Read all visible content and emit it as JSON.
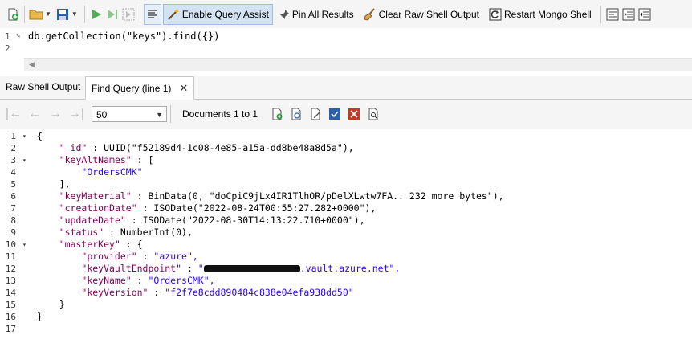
{
  "toolbar": {
    "new_icon": "new-document-icon",
    "open_icon": "folder-open-icon",
    "save_icon": "save-icon",
    "run_icon": "play-icon",
    "run_line_icon": "play-line-icon",
    "run_selected_icon": "play-selection-icon",
    "enable_query_assist": "Enable Query Assist",
    "pin_all_results": "Pin All Results",
    "clear_raw_shell_output": "Clear Raw Shell Output",
    "restart_mongo_shell": "Restart Mongo Shell"
  },
  "editor": {
    "lines": [
      {
        "number": "1",
        "text": "db.getCollection(\"keys\").find({})"
      },
      {
        "number": "2",
        "text": ""
      }
    ]
  },
  "tabs": [
    {
      "label": "Raw Shell Output",
      "active": false
    },
    {
      "label": "Find Query (line 1)",
      "active": true,
      "close": "✕"
    }
  ],
  "results": {
    "page_size": "50",
    "documents_label": "Documents 1 to 1"
  },
  "code": {
    "line_numbers": [
      "1",
      "2",
      "3",
      "4",
      "5",
      "6",
      "7",
      "8",
      "9",
      "10",
      "11",
      "12",
      "13",
      "14",
      "15",
      "16",
      "17"
    ],
    "l1": "{",
    "id_key": "\"_id\"",
    "id_val": "UUID(\"f52189d4-1c08-4e85-a15a-dd8be48a8d5a\"),",
    "keyAltNames_key": "\"keyAltNames\"",
    "keyAltNames_open": "[",
    "alt_name": "\"OrdersCMK\"",
    "keyAltNames_close": "],",
    "keyMaterial_key": "\"keyMaterial\"",
    "keyMaterial_val": "BinData(0, \"doCpiC9jLx4IR1TlhOR/pDelXLwtw7FA.. 232 more bytes\"),",
    "creationDate_key": "\"creationDate\"",
    "creationDate_val": "ISODate(\"2022-08-24T00:55:27.282+0000\"),",
    "updateDate_key": "\"updateDate\"",
    "updateDate_val": "ISODate(\"2022-08-30T14:13:22.710+0000\"),",
    "status_key": "\"status\"",
    "status_val": "NumberInt(0),",
    "masterKey_key": "\"masterKey\"",
    "masterKey_open": "{",
    "provider_key": "\"provider\"",
    "provider_val": "\"azure\",",
    "keyVaultEndpoint_key": "\"keyVaultEndpoint\"",
    "keyVaultEndpoint_prefix": "\"",
    "keyVaultEndpoint_suffix": ".vault.azure.net\",",
    "keyName_key": "\"keyName\"",
    "keyName_val": "\"OrdersCMK\",",
    "keyVersion_key": "\"keyVersion\"",
    "keyVersion_val": "\"f2f7e8cdd890484c838e04efa938dd50\"",
    "masterKey_close": "}",
    "l16": "}",
    "sep": " : "
  },
  "colors": {
    "keyword": "#7f0055",
    "string": "#2a00ff",
    "active_button_bg": "#d4e3f4"
  }
}
